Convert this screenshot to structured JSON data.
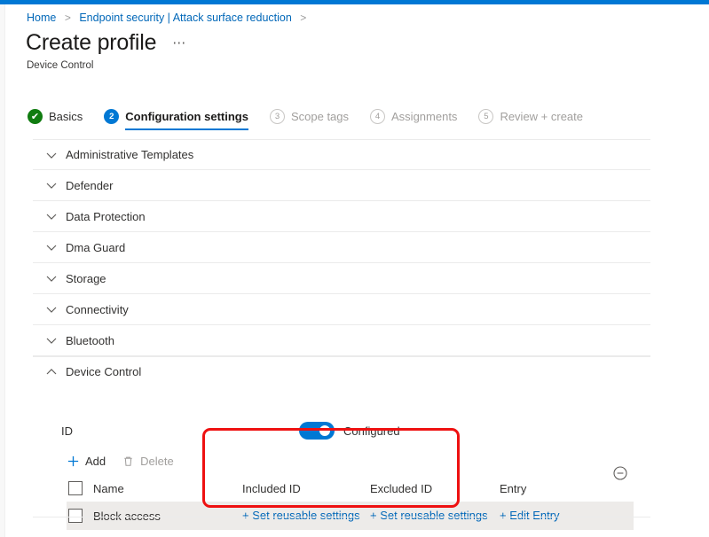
{
  "theme": {
    "accent": "#0078d4",
    "link": "#0067b8",
    "success": "#107c10",
    "disabled_text": "#a19f9d",
    "row_highlight": "#edebe9",
    "annotation_red": "#ee1111"
  },
  "breadcrumb": {
    "items": [
      {
        "label": "Home"
      },
      {
        "label": "Endpoint security | Attack surface reduction"
      }
    ],
    "separator": ">"
  },
  "header": {
    "title": "Create profile",
    "ellipsis": "⋯",
    "subtitle": "Device Control"
  },
  "wizard": {
    "steps": [
      {
        "badge": "✔",
        "label": "Basics",
        "state": "done"
      },
      {
        "badge": "2",
        "label": "Configuration settings",
        "state": "active"
      },
      {
        "badge": "3",
        "label": "Scope tags",
        "state": "todo"
      },
      {
        "badge": "4",
        "label": "Assignments",
        "state": "todo"
      },
      {
        "badge": "5",
        "label": "Review + create",
        "state": "todo"
      }
    ]
  },
  "sections": [
    {
      "label": "Administrative Templates",
      "expanded": false
    },
    {
      "label": "Defender",
      "expanded": false
    },
    {
      "label": "Data Protection",
      "expanded": false
    },
    {
      "label": "Dma Guard",
      "expanded": false
    },
    {
      "label": "Storage",
      "expanded": false
    },
    {
      "label": "Connectivity",
      "expanded": false
    },
    {
      "label": "Bluetooth",
      "expanded": false
    }
  ],
  "device_control": {
    "title": "Device Control",
    "expanded": true,
    "setting_label": "ID",
    "toggle": {
      "state": "on",
      "label": "Configured"
    },
    "commands": [
      {
        "id": "add",
        "label": "Add",
        "icon": "plus-icon",
        "enabled": true
      },
      {
        "id": "delete",
        "label": "Delete",
        "icon": "trash-icon",
        "enabled": false
      }
    ],
    "table": {
      "columns": [
        "Name",
        "Included ID",
        "Excluded ID",
        "Entry"
      ],
      "rows": [
        {
          "checked": false,
          "name": "Block access",
          "included_id": "+ Set reusable settings",
          "excluded_id": "+ Set reusable settings",
          "entry": "+ Edit Entry"
        }
      ]
    },
    "remove_icon": "circle-minus-icon"
  }
}
